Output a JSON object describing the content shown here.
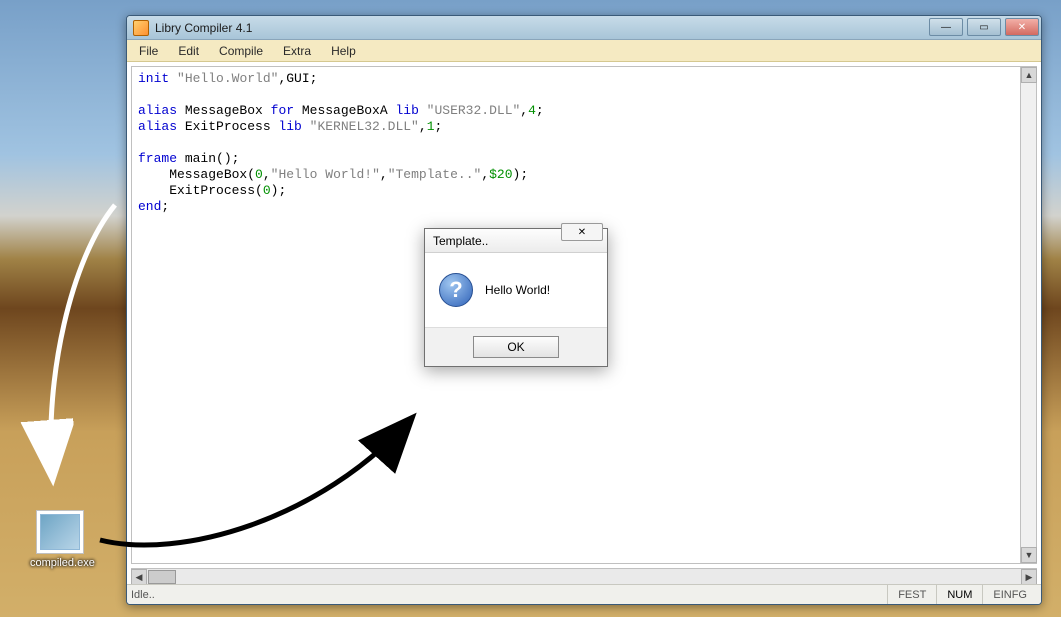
{
  "window": {
    "title": "Libry Compiler 4.1",
    "controls": {
      "min": "—",
      "max": "▭",
      "close": "✕"
    }
  },
  "menu": {
    "file": "File",
    "edit": "Edit",
    "compile": "Compile",
    "extra": "Extra",
    "help": "Help"
  },
  "code": {
    "l1_kw": "init",
    "l1_str": "\"Hello.World\"",
    "l1_tail": ",GUI;",
    "l3_kw": "alias",
    "l3_a": " MessageBox ",
    "l3_for": "for",
    "l3_b": " MessageBoxA ",
    "l3_lib": "lib",
    "l3_str": " \"USER32.DLL\"",
    "l3_c": ",",
    "l3_num": "4",
    "l3_end": ";",
    "l4_kw": "alias",
    "l4_a": " ExitProcess ",
    "l4_lib": "lib",
    "l4_str": " \"KERNEL32.DLL\"",
    "l4_c": ",",
    "l4_num": "1",
    "l4_end": ";",
    "l6_kw": "frame",
    "l6_tail": " main();",
    "l7_call": "    MessageBox(",
    "l7_n1": "0",
    "l7_c1": ",",
    "l7_s1": "\"Hello World!\"",
    "l7_c2": ",",
    "l7_s2": "\"Template..\"",
    "l7_c3": ",",
    "l7_n2": "$20",
    "l7_end": ");",
    "l8_call": "    ExitProcess(",
    "l8_n": "0",
    "l8_end": ");",
    "l9_kw": "end",
    "l9_end": ";"
  },
  "statusbar": {
    "idle": "Idle..",
    "fest": "FEST",
    "num": "NUM",
    "einfg": "EINFG"
  },
  "dialog": {
    "title": "Template..",
    "close": "✕",
    "icon_char": "?",
    "message": "Hello World!",
    "ok": "OK"
  },
  "desktop_icon": {
    "label": "compiled.exe"
  }
}
